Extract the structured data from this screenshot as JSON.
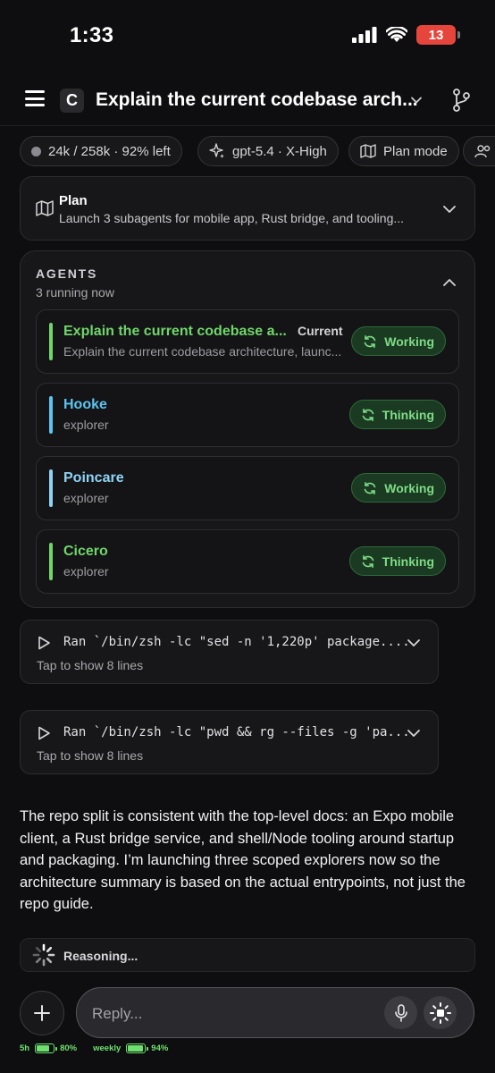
{
  "status_bar": {
    "time": "1:33",
    "battery": "13"
  },
  "header": {
    "title": "Explain the current codebase arch...",
    "logo": "C"
  },
  "chips": [
    {
      "label": "24k / 258k · 92% left"
    },
    {
      "label": "gpt-5.4 · X-High"
    },
    {
      "label": "Plan mode"
    }
  ],
  "plan": {
    "title": "Plan",
    "subtitle": "Launch 3 subagents for mobile app, Rust bridge, and tooling..."
  },
  "agents": {
    "title": "AGENTS",
    "subtitle": "3 running now",
    "items": [
      {
        "name": "Explain the current codebase a...",
        "role": "Explain the current codebase architecture, launc...",
        "tag": "Current",
        "status": "Working",
        "color": "#6fd66a"
      },
      {
        "name": "Hooke",
        "role": "explorer",
        "status": "Thinking",
        "color": "#5bc4f0"
      },
      {
        "name": "Poincare",
        "role": "explorer",
        "status": "Working",
        "color": "#8fd3f4"
      },
      {
        "name": "Cicero",
        "role": "explorer",
        "status": "Thinking",
        "color": "#6fd66a"
      }
    ]
  },
  "runs": [
    {
      "command": "Ran `/bin/zsh -lc \"sed -n '1,220p' package....",
      "subtitle": "Tap to show 8 lines"
    },
    {
      "command": "Ran `/bin/zsh -lc \"pwd && rg --files -g 'pa...",
      "subtitle": "Tap to show 8 lines"
    }
  ],
  "message": "The repo split is consistent with the top-level docs: an Expo mobile client, a Rust bridge service, and shell/Node tooling around startup and packaging. I’m launching three scoped explorers now so the architecture summary is based on the actual entrypoints, not just the repo guide.",
  "reasoning": "Reasoning...",
  "composer": {
    "placeholder": "Reply..."
  },
  "footer": {
    "session_label": "5h",
    "session_pct": "80%",
    "session_fill": 0.8,
    "weekly_label": "weekly",
    "weekly_pct": "94%",
    "weekly_fill": 0.94
  }
}
